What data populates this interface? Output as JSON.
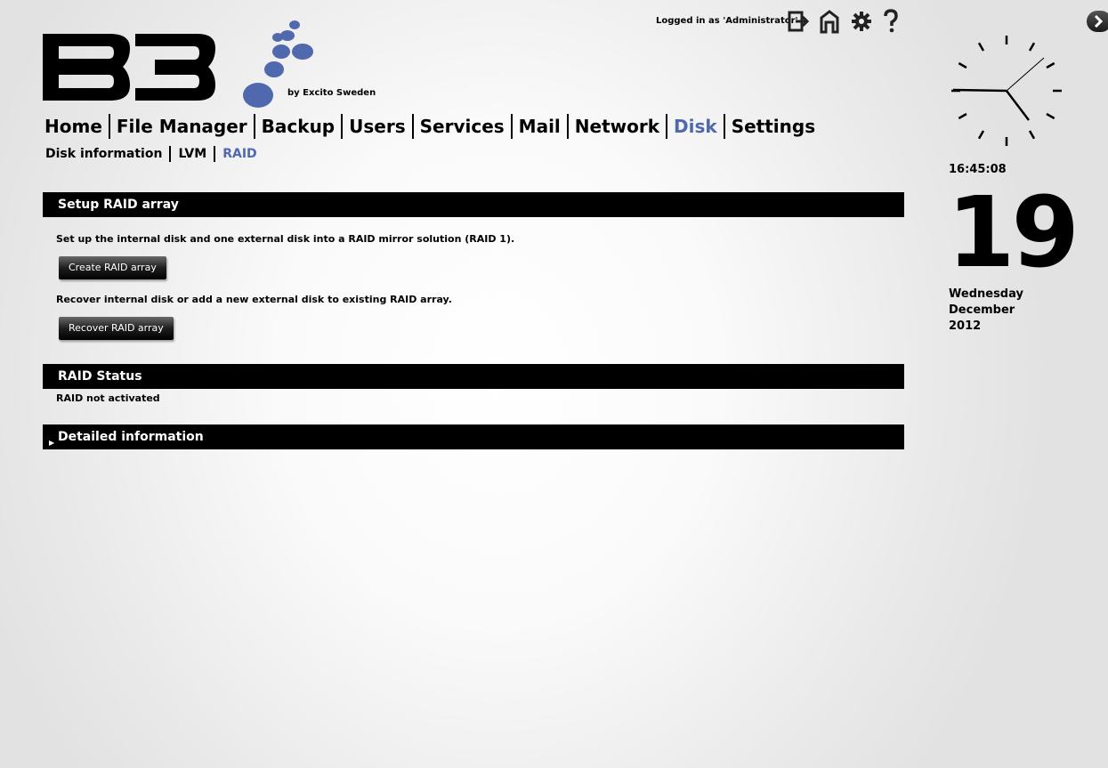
{
  "brand": {
    "logo_text": "B3",
    "tagline": "by Excito Sweden",
    "dot_color": "#5068ad"
  },
  "header": {
    "login_text": "Logged in as 'Administrator'",
    "icons": [
      "logout-icon",
      "home-icon",
      "settings-gear-icon",
      "help-icon"
    ]
  },
  "nav": {
    "items": [
      {
        "label": "Home"
      },
      {
        "label": "File Manager"
      },
      {
        "label": "Backup"
      },
      {
        "label": "Users"
      },
      {
        "label": "Services"
      },
      {
        "label": "Mail"
      },
      {
        "label": "Network"
      },
      {
        "label": "Disk"
      },
      {
        "label": "Settings"
      }
    ],
    "active": "Disk",
    "active_color": "#5068ad"
  },
  "subnav": {
    "items": [
      {
        "label": "Disk information"
      },
      {
        "label": "LVM"
      },
      {
        "label": "RAID"
      }
    ],
    "active": "RAID"
  },
  "setup": {
    "title": "Setup RAID array",
    "create_desc": "Set up the internal disk and one external disk into a RAID mirror solution (RAID 1).",
    "create_button": "Create RAID array",
    "recover_desc": "Recover internal disk or add a new external disk to existing RAID array.",
    "recover_button": "Recover RAID array"
  },
  "status": {
    "title": "RAID Status",
    "text": "RAID not activated"
  },
  "details": {
    "title": "Detailed information",
    "collapsed": true
  },
  "sidebar": {
    "time": "16:45:08",
    "day": "19",
    "weekday": "Wednesday",
    "month": "December",
    "year": "2012"
  }
}
